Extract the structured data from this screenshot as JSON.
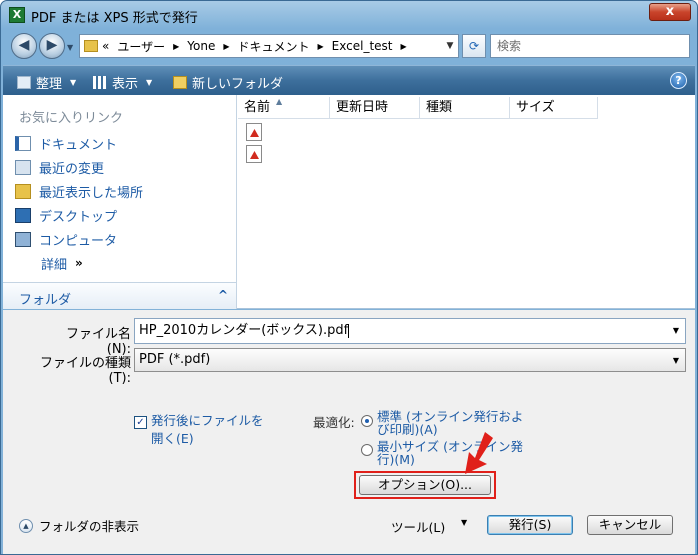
{
  "window": {
    "title": "PDF または XPS 形式で発行",
    "app_icon_letter": "X",
    "close_glyph": "x"
  },
  "address": {
    "parts": [
      "«",
      "ユーザー",
      "Yone",
      "ドキュメント",
      "Excel_test"
    ],
    "search_placeholder": "検索"
  },
  "toolbar": {
    "organize": "整理",
    "views": "表示",
    "new_folder": "新しいフォルダ",
    "help": "?"
  },
  "navpane": {
    "favorites_title": "お気に入りリンク",
    "items": [
      {
        "label": "ドキュメント",
        "icon": "documents-icon"
      },
      {
        "label": "最近の変更",
        "icon": "recent-changes-icon"
      },
      {
        "label": "最近表示した場所",
        "icon": "recent-places-icon"
      },
      {
        "label": "デスクトップ",
        "icon": "desktop-icon"
      },
      {
        "label": "コンピュータ",
        "icon": "computer-icon"
      }
    ],
    "details": "詳細",
    "folders": "フォルダ"
  },
  "files": {
    "columns": [
      "名前",
      "更新日時",
      "種類",
      "サイズ"
    ],
    "rows": [
      {
        "icon": "pdf-file-icon"
      },
      {
        "icon": "pdf-file-icon"
      }
    ]
  },
  "form": {
    "filename_label": "ファイル名(N):",
    "filename_value": "HP_2010カレンダー(ボックス).pdf",
    "filetype_label": "ファイルの種類(T):",
    "filetype_value": "PDF (*.pdf)",
    "open_after_line1": "発行後にファイルを",
    "open_after_line2": "開く(E)",
    "open_after_checked": true,
    "optimize_label": "最適化:",
    "opt_standard_line1": "標準 (オンライン発行およ",
    "opt_standard_line2": "び印刷)(A)",
    "opt_minimum_line1": "最小サイズ (オンライン発",
    "opt_minimum_line2": "行)(M)",
    "options_button": "オプション(O)..."
  },
  "footer": {
    "hide_folders": "フォルダの非表示",
    "tools": "ツール(L)",
    "publish": "発行(S)",
    "cancel": "キャンセル"
  },
  "colors": {
    "accent": "#1d5ba5",
    "highlight_red": "#e0201a",
    "toolbar": "#3d6f9c"
  }
}
